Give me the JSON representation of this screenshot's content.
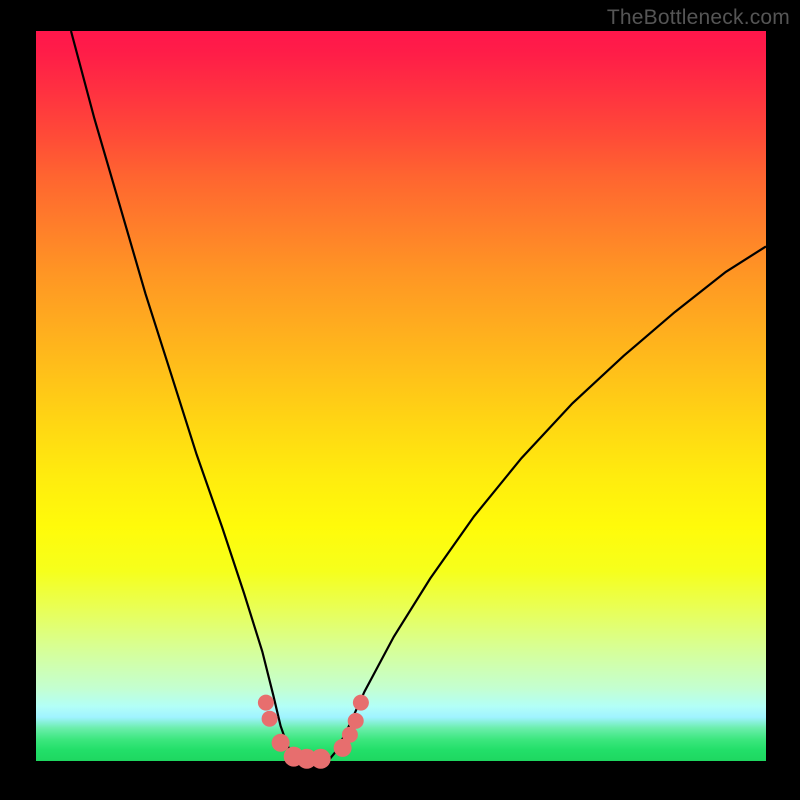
{
  "watermark": "TheBottleneck.com",
  "chart_data": {
    "type": "line",
    "title": "",
    "xlabel": "",
    "ylabel": "",
    "xlim": [
      0,
      1
    ],
    "ylim": [
      0,
      1
    ],
    "series": [
      {
        "name": "left-curve",
        "x": [
          0.048,
          0.08,
          0.115,
          0.15,
          0.185,
          0.22,
          0.255,
          0.285,
          0.31,
          0.325,
          0.335,
          0.345,
          0.355,
          0.36
        ],
        "y": [
          1.0,
          0.88,
          0.76,
          0.64,
          0.53,
          0.42,
          0.32,
          0.23,
          0.15,
          0.09,
          0.048,
          0.02,
          0.006,
          0.0
        ]
      },
      {
        "name": "right-curve",
        "x": [
          0.4,
          0.41,
          0.425,
          0.45,
          0.49,
          0.54,
          0.6,
          0.665,
          0.735,
          0.805,
          0.875,
          0.945,
          1.0
        ],
        "y": [
          0.0,
          0.012,
          0.04,
          0.095,
          0.17,
          0.25,
          0.335,
          0.415,
          0.49,
          0.555,
          0.615,
          0.67,
          0.705
        ]
      }
    ],
    "marker_points": {
      "comment": "salmon dots near trough",
      "x": [
        0.315,
        0.32,
        0.335,
        0.353,
        0.371,
        0.39,
        0.42,
        0.43,
        0.438,
        0.445
      ],
      "y": [
        0.08,
        0.058,
        0.025,
        0.006,
        0.003,
        0.003,
        0.018,
        0.036,
        0.055,
        0.08
      ],
      "r": [
        8,
        8,
        9,
        10,
        10,
        10,
        9,
        8,
        8,
        8
      ]
    },
    "marker_color": "#e76e6e",
    "curve_color": "#000000",
    "curve_width": 2.2
  }
}
